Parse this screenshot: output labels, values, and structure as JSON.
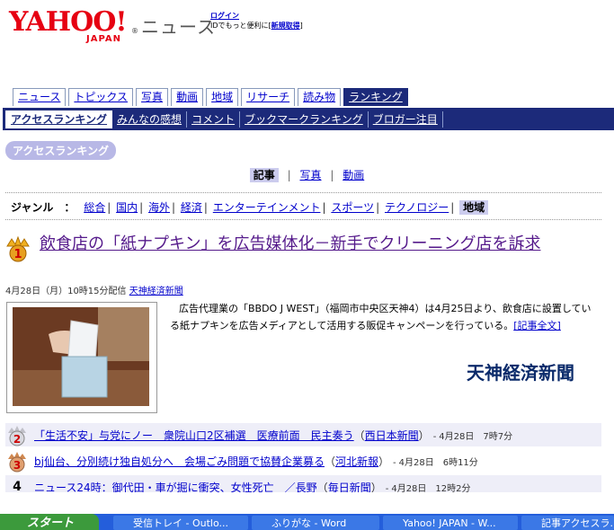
{
  "header": {
    "logo_text": "YAHOO!",
    "logo_sub": "JAPAN",
    "logo_r": "®",
    "section_title": "ニュース",
    "login_link": "ログイン",
    "login_note": "IDでもっと便利に[",
    "register_link": "新規取得",
    "login_note_end": "]"
  },
  "tabs": [
    {
      "label": "ニュース",
      "active": false
    },
    {
      "label": "トピックス",
      "active": false
    },
    {
      "label": "写真",
      "active": false
    },
    {
      "label": "動画",
      "active": false
    },
    {
      "label": "地域",
      "active": false
    },
    {
      "label": "リサーチ",
      "active": false
    },
    {
      "label": "読み物",
      "active": false
    },
    {
      "label": "ランキング",
      "active": true
    }
  ],
  "subnav": [
    {
      "label": "アクセスランキング",
      "active": true
    },
    {
      "label": "みんなの感想",
      "active": false
    },
    {
      "label": "コメント",
      "active": false
    },
    {
      "label": "ブックマークランキング",
      "active": false
    },
    {
      "label": "ブロガー注目",
      "active": false
    }
  ],
  "section_badge": "アクセスランキング",
  "content_switch": {
    "current": "記事",
    "links": [
      "写真",
      "動画"
    ],
    "separator": "|"
  },
  "genre": {
    "label": "ジャンル　：",
    "items": [
      "総合",
      "国内",
      "海外",
      "経済",
      "エンターテインメント",
      "スポーツ",
      "テクノロジー"
    ],
    "current": "地域",
    "separator": "|"
  },
  "top_article": {
    "rank": "1",
    "headline": "飲食店の「紙ナプキン」を広告媒体化－新手でクリーニング店を訴求",
    "dateline": "4月28日（月）10時15分配信",
    "source": "天神経済新聞",
    "body": "広告代理業の「BBDO J WEST」（福岡市中央区天神4）は4月25日より、飲食店に設置している紙ナプキンを広告メディアとして活用する販促キャンペーンを行っている。",
    "more_link": "[記事全文]",
    "source_logo": "天神経済新聞"
  },
  "rankings": [
    {
      "rank": "2",
      "title": "「生活不安」与党にノー　衆院山口2区補選　医療前面　民主奏う",
      "source": "西日本新聞",
      "time": "4月28日　7時7分"
    },
    {
      "rank": "3",
      "title": "bj仙台、分別続け独自処分へ　会場ごみ問題で協賛企業募る",
      "source": "河北新報",
      "time": "4月28日　6時11分"
    },
    {
      "rank": "4",
      "title": "ニュース24時：御代田・車が掘に衝突、女性死亡　／長野",
      "source": "毎日新聞",
      "time": "4月28日　12時2分"
    }
  ],
  "taskbar": {
    "start_label": "スタート",
    "buttons": [
      "受信トレイ - Outlo...",
      "ふりがな - Word",
      "Yahoo! JAPAN - W...",
      "記事アクセスラ..."
    ]
  },
  "colors": {
    "brand_red": "#e60012",
    "nav_blue": "#1c2a7a",
    "badge_lavender": "#b8b8e6",
    "link_blue": "#0000cc",
    "visited_purple": "#551a8b"
  }
}
